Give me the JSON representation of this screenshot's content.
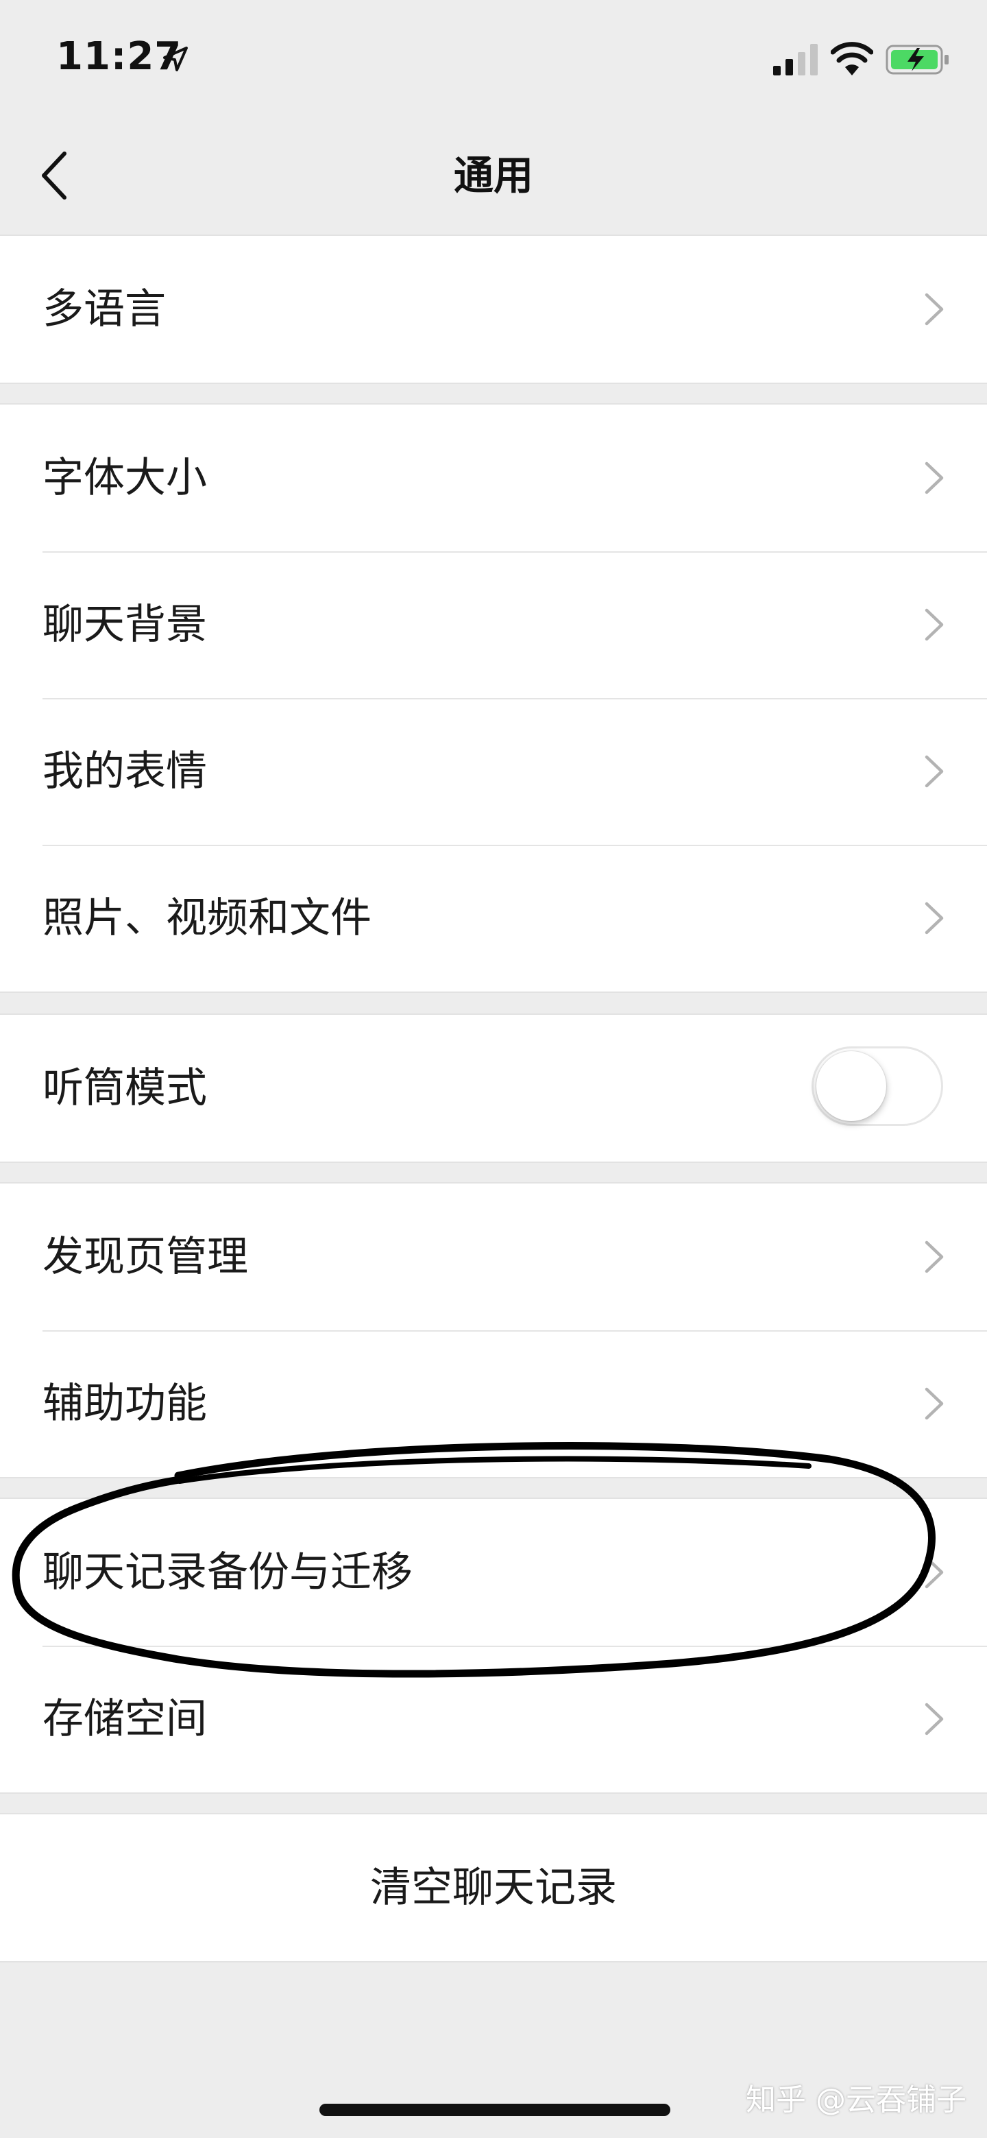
{
  "status_bar": {
    "time": "11:27",
    "location_icon": "location-arrow-icon",
    "signal_icon": "cellular-signal-icon",
    "wifi_icon": "wifi-icon",
    "battery_icon": "battery-charging-icon",
    "battery_color": "#4cd964"
  },
  "nav": {
    "back_icon": "chevron-left-icon",
    "title": "通用"
  },
  "groups": [
    {
      "items": [
        {
          "label": "多语言",
          "accessory": "chevron"
        }
      ]
    },
    {
      "items": [
        {
          "label": "字体大小",
          "accessory": "chevron"
        },
        {
          "label": "聊天背景",
          "accessory": "chevron"
        },
        {
          "label": "我的表情",
          "accessory": "chevron"
        },
        {
          "label": "照片、视频和文件",
          "accessory": "chevron"
        }
      ]
    },
    {
      "items": [
        {
          "label": "听筒模式",
          "accessory": "toggle",
          "toggle_on": false
        }
      ]
    },
    {
      "items": [
        {
          "label": "发现页管理",
          "accessory": "chevron"
        },
        {
          "label": "辅助功能",
          "accessory": "chevron"
        }
      ]
    },
    {
      "items": [
        {
          "label": "聊天记录备份与迁移",
          "accessory": "chevron"
        },
        {
          "label": "存储空间",
          "accessory": "chevron"
        }
      ]
    }
  ],
  "clear_chat": {
    "label": "清空聊天记录"
  },
  "watermark": "知乎 @云吞铺子",
  "colors": {
    "background": "#ededed",
    "cell": "#ffffff",
    "separator": "#e4e4e4",
    "chevron": "#b3b3b3",
    "annotation_ink": "#000000"
  }
}
